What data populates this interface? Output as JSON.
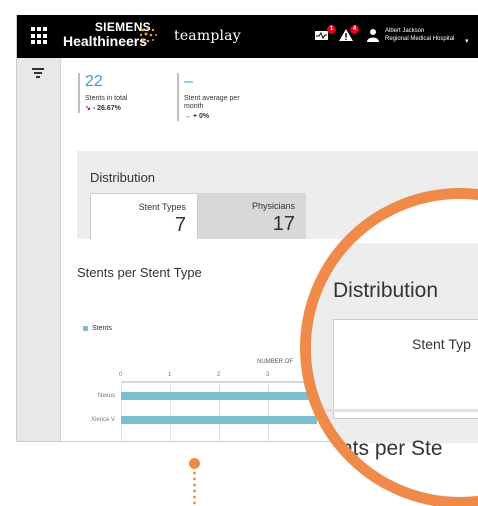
{
  "header": {
    "brand_line1": "SIEMENS",
    "brand_line2": "Healthineers",
    "app_name": "teamplay",
    "monitor_badge": "1",
    "alert_badge": "4",
    "user_name": "Albert Jackson",
    "user_org": "Regional Medical Hospital",
    "caret": "▾"
  },
  "kpis": [
    {
      "value": "22",
      "label": "Stents in total",
      "trend_arrow": "↘",
      "trend": " - 26.67%",
      "trend_color": "#e2001a"
    },
    {
      "value": "–",
      "label_l1": "Stent average per",
      "label_l2": "month",
      "trend_arrow": "→",
      "trend": " + 0%"
    }
  ],
  "distribution": {
    "title": "Distribution",
    "tabs": [
      {
        "label": "Stent Types",
        "value": "7"
      },
      {
        "label": "Physicians",
        "value": "17"
      }
    ]
  },
  "chart_data": {
    "type": "bar",
    "title": "Stents per Stent Type",
    "legend": [
      "Stents"
    ],
    "xlabel": "NUMBER OF",
    "x_ticks": [
      "0",
      "1",
      "2",
      "3"
    ],
    "categories": [
      "Nexus",
      "Xience V"
    ],
    "series": [
      {
        "name": "Stents",
        "values": [
          4,
          4
        ]
      }
    ],
    "color": "#7dbfd1"
  },
  "magnifier": {
    "title": "Distribution",
    "tab_label": "Stent Typ",
    "chart_title": "nts per Ste",
    "ring_color": "#f08a4b"
  }
}
